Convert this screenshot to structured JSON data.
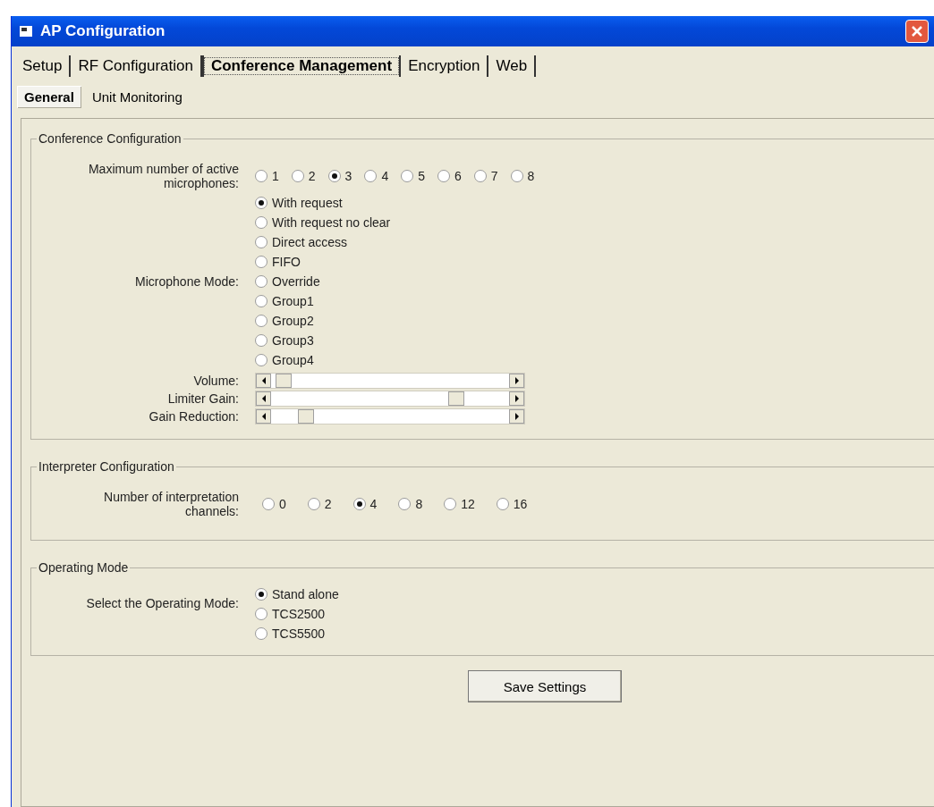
{
  "window": {
    "title": "AP Configuration"
  },
  "tabs": [
    {
      "label": "Setup",
      "selected": false
    },
    {
      "label": "RF Configuration",
      "selected": false
    },
    {
      "label": "Conference Management",
      "selected": true
    },
    {
      "label": "Encryption",
      "selected": false
    },
    {
      "label": "Web",
      "selected": false
    }
  ],
  "subtabs": [
    {
      "label": "General",
      "selected": true
    },
    {
      "label": "Unit Monitoring",
      "selected": false
    }
  ],
  "conference": {
    "title": "Conference Configuration",
    "max_microphones": {
      "label": "Maximum number of active microphones:",
      "options": [
        {
          "label": "1",
          "selected": false
        },
        {
          "label": "2",
          "selected": false
        },
        {
          "label": "3",
          "selected": true
        },
        {
          "label": "4",
          "selected": false
        },
        {
          "label": "5",
          "selected": false
        },
        {
          "label": "6",
          "selected": false
        },
        {
          "label": "7",
          "selected": false
        },
        {
          "label": "8",
          "selected": false
        }
      ]
    },
    "microphone_mode": {
      "label": "Microphone Mode:",
      "options": [
        {
          "label": "With request",
          "selected": true
        },
        {
          "label": "With request no clear",
          "selected": false
        },
        {
          "label": "Direct access",
          "selected": false
        },
        {
          "label": "FIFO",
          "selected": false
        },
        {
          "label": "Override",
          "selected": false
        },
        {
          "label": "Group1",
          "selected": false
        },
        {
          "label": "Group2",
          "selected": false
        },
        {
          "label": "Group3",
          "selected": false
        },
        {
          "label": "Group4",
          "selected": false
        }
      ]
    },
    "sliders": [
      {
        "label": "Volume:",
        "level": 0.02
      },
      {
        "label": "Limiter Gain:",
        "level": 0.8
      },
      {
        "label": "Gain Reduction:",
        "level": 0.12
      }
    ]
  },
  "interpreter": {
    "title": "Interpreter Configuration",
    "channels": {
      "label": "Number of interpretation channels:",
      "options": [
        {
          "label": "0",
          "selected": false
        },
        {
          "label": "2",
          "selected": false
        },
        {
          "label": "4",
          "selected": true
        },
        {
          "label": "8",
          "selected": false
        },
        {
          "label": "12",
          "selected": false
        },
        {
          "label": "16",
          "selected": false
        }
      ]
    }
  },
  "operating_mode": {
    "title": "Operating Mode",
    "mode": {
      "label": "Select the Operating Mode:",
      "options": [
        {
          "label": "Stand alone",
          "selected": true
        },
        {
          "label": "TCS2500",
          "selected": false
        },
        {
          "label": "TCS5500",
          "selected": false
        }
      ]
    }
  },
  "save_button": "Save Settings"
}
